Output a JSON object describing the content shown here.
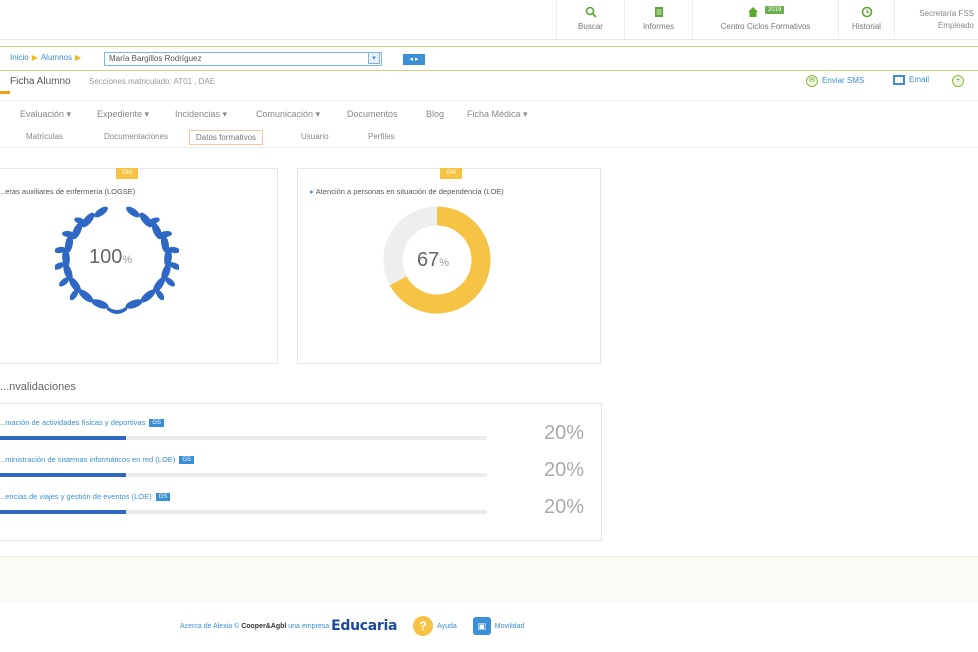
{
  "topbar": {
    "items": [
      {
        "label": "Buscar",
        "icon": "search-icon"
      },
      {
        "label": "Informes",
        "icon": "report-icon"
      },
      {
        "label": "Centro Ciclos Formativos",
        "icon": "home-icon",
        "badge": "2019"
      },
      {
        "label": "Historial",
        "icon": "history-icon"
      }
    ],
    "user_line1": "Secretaría FSS",
    "user_line2": "Empleado"
  },
  "breadcrumb": {
    "home": "Inicio",
    "alumnos": "Alumnos",
    "student_value": "María Bargillos Rodríguez",
    "nav_arrows": "◂ ▸"
  },
  "header": {
    "title": "Ficha Alumno",
    "subtitle": "Secciones matriculado: AT01 , DAE",
    "actions": [
      {
        "label": "Enviar SMS",
        "icon": "sms-icon"
      },
      {
        "label": "Email",
        "icon": "email-icon"
      }
    ]
  },
  "menu": {
    "items": [
      "Evaluación ▾",
      "Expediente ▾",
      "Incidencias ▾",
      "Comunicación ▾",
      "Documentos",
      "Blog",
      "Ficha Médica ▾"
    ]
  },
  "subtabs": {
    "items": [
      "Matrículas",
      "Documentaciones",
      "Datos formativos",
      "Usuario",
      "Perfiles"
    ],
    "active_index": 2
  },
  "cards": [
    {
      "tag": "GM",
      "title": "...eras auxiliares de enfermería (LOGSE)",
      "value": 100,
      "unit": "%",
      "kind": "wreath"
    },
    {
      "tag": "GM",
      "title": "Atención a personas en situación de dependencia (LOE)",
      "value": 67,
      "unit": "%",
      "kind": "donut"
    }
  ],
  "convalidaciones": {
    "title": "...nvalidaciones",
    "rows": [
      {
        "label": "...mación de actividades físicas y deportivas",
        "badge": "GS",
        "percent_text": "20%",
        "progress": 0.26
      },
      {
        "label": "...ministración de sistemas informáticos en red (LOE)",
        "badge": "GS",
        "percent_text": "20%",
        "progress": 0.26
      },
      {
        "label": "...encias de viajes y gestión de eventos (LOE)",
        "badge": "GS",
        "percent_text": "20%",
        "progress": 0.26
      }
    ]
  },
  "footer": {
    "about": "Acerca de Alexia ©",
    "company": "Cooper&Agbl",
    "company_suffix": "una empresa",
    "brand": "Educaria",
    "help": "Ayuda",
    "mobile": "Movilidad"
  },
  "colors": {
    "accent": "#3a8fd6",
    "gold": "#f7c344",
    "bar_blue": "#2e68c4",
    "green": "#6ab04c"
  }
}
